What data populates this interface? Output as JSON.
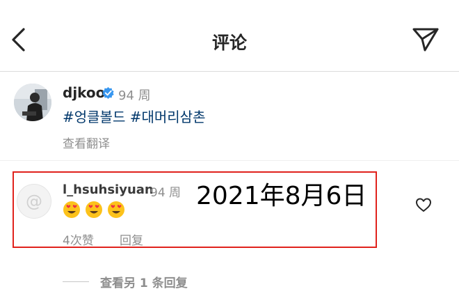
{
  "header": {
    "title": "评论",
    "back_icon": "chevron-left-icon",
    "send_icon": "paper-plane-icon"
  },
  "caption": {
    "username": "djkoo",
    "verified": true,
    "time": "94 周",
    "text": "#엉클볼드 #대머리삼촌",
    "translate_label": "查看翻译"
  },
  "comment": {
    "username": "l_hsuhsiyuan",
    "time": "94 周",
    "emojis": [
      "heart-eyes-face",
      "heart-eyes-face",
      "heart-eyes-face"
    ],
    "likes": "4次赞",
    "reply_label": "回复",
    "like_icon": "heart-outline-icon"
  },
  "annotation": {
    "date": "2021年8月6日",
    "box_color": "#e0221c"
  },
  "replies": {
    "label": "查看另 1 条回复"
  },
  "colors": {
    "link": "#00376b",
    "muted": "#8e8e8e",
    "verified": "#3897f0"
  }
}
